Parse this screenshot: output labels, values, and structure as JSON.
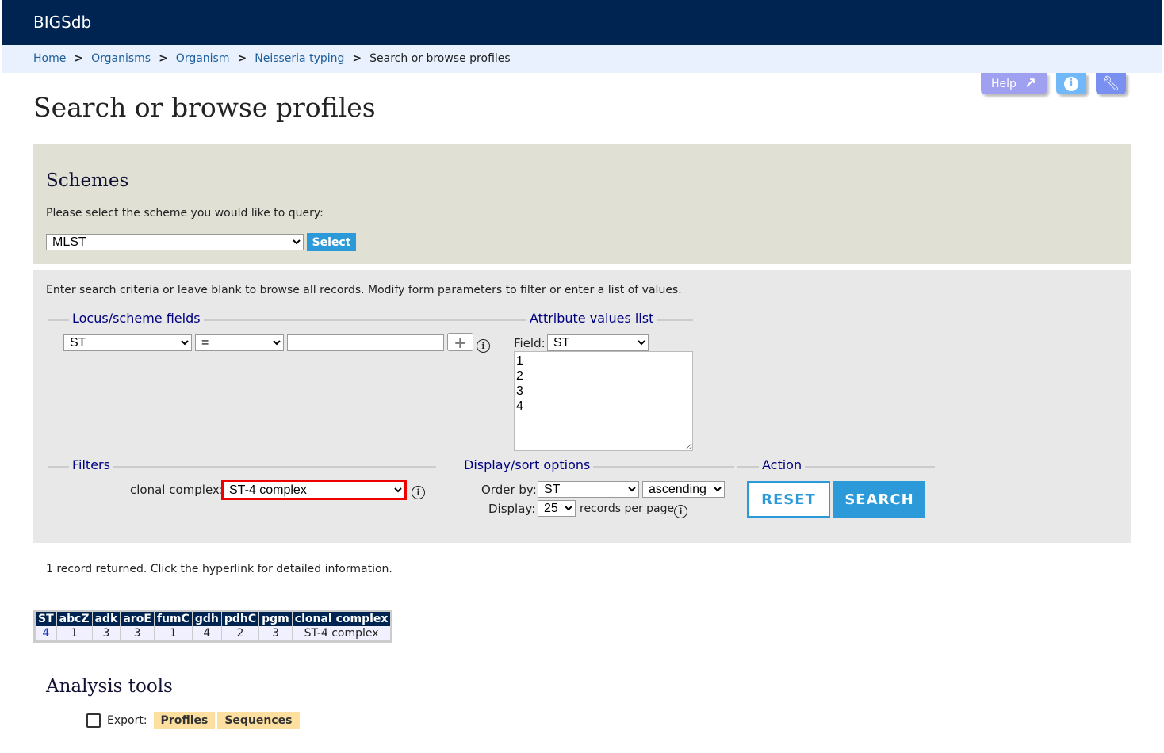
{
  "app": {
    "title": "BIGSdb"
  },
  "breadcrumb": [
    {
      "label": "Home"
    },
    {
      "label": "Organisms"
    },
    {
      "label": "Organism"
    },
    {
      "label": "Neisseria typing"
    }
  ],
  "breadcrumb_current": "Search or browse profiles",
  "header_buttons": {
    "help": "Help",
    "help_color": "#a0a0f0",
    "info_color": "#70b8f8",
    "config_color": "#7a90f0"
  },
  "page_title": "Search or browse profiles",
  "schemes": {
    "heading": "Schemes",
    "prompt": "Please select the scheme you would like to query:",
    "selected": "MLST",
    "select_label": "Select"
  },
  "form": {
    "intro": "Enter search criteria or leave blank to browse all records. Modify form parameters to filter or enter a list of values.",
    "locus_legend": "Locus/scheme fields",
    "locus_field": "ST",
    "operator": "=",
    "value": "",
    "attr_legend": "Attribute values list",
    "field_label": "Field:",
    "field_value": "ST",
    "values_list": "1\n2\n3\n4",
    "filters_legend": "Filters",
    "clonal_label": "clonal complex:",
    "clonal_value": "ST-4 complex",
    "display_legend": "Display/sort options",
    "order_label": "Order by:",
    "order_value": "ST",
    "direction": "ascending",
    "display_label": "Display:",
    "display_value": "25",
    "per_page": "records per page",
    "action_legend": "Action",
    "reset": "RESET",
    "search": "SEARCH"
  },
  "results": {
    "message": "1 record returned. Click the hyperlink for detailed information.",
    "columns": [
      "ST",
      "abcZ",
      "adk",
      "aroE",
      "fumC",
      "gdh",
      "pdhC",
      "pgm",
      "clonal complex"
    ],
    "rows": [
      [
        "4",
        "1",
        "3",
        "3",
        "1",
        "4",
        "2",
        "3",
        "ST-4 complex"
      ]
    ]
  },
  "analysis": {
    "heading": "Analysis tools",
    "export_label": "Export:",
    "profiles": "Profiles",
    "sequences": "Sequences"
  }
}
